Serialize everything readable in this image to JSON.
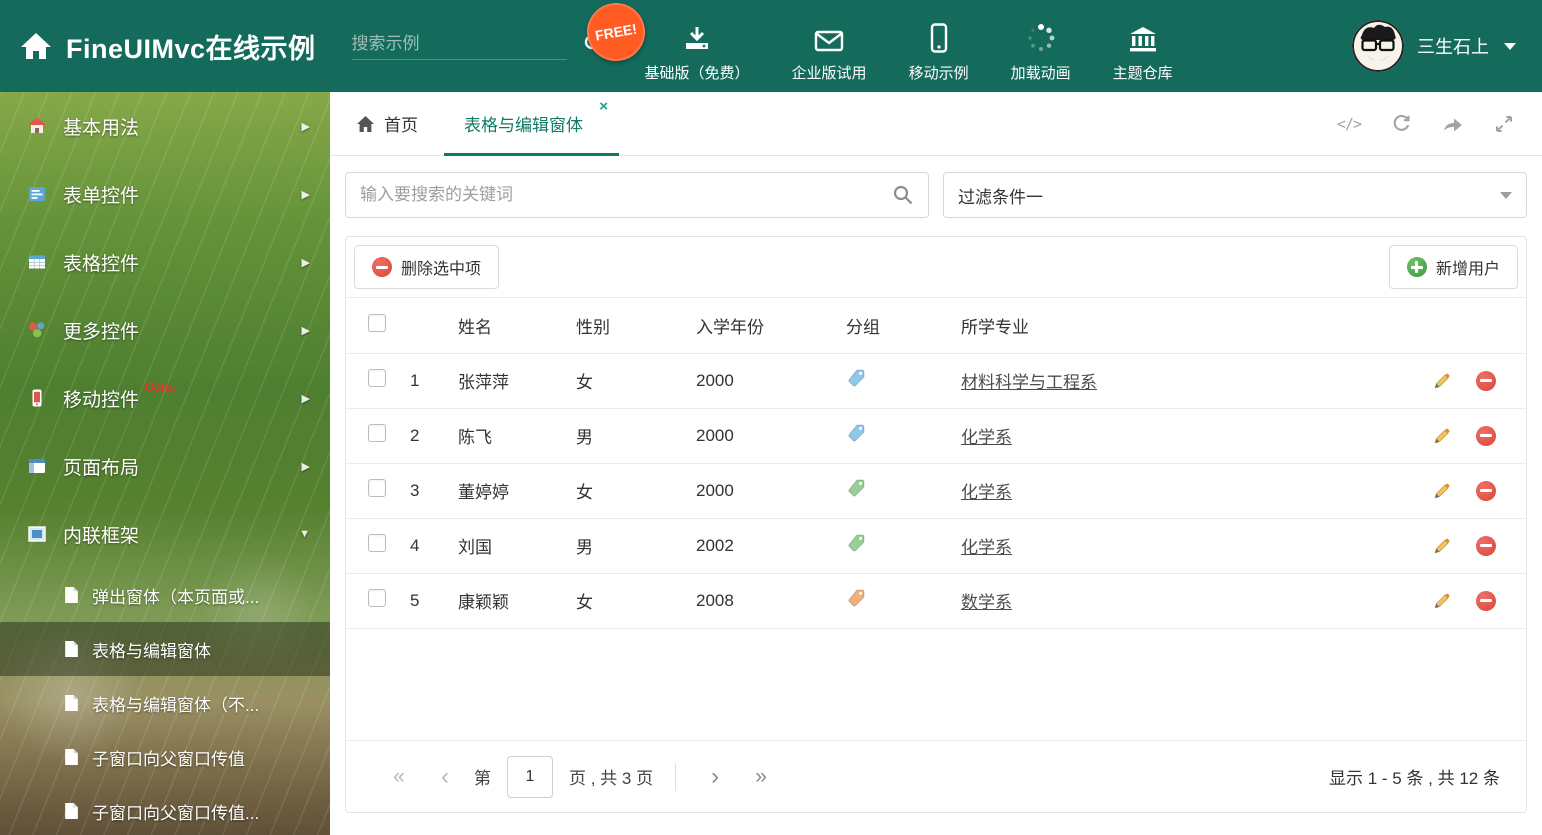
{
  "colors": {
    "header_bg": "#146b5c",
    "accent": "#107a67",
    "free_badge": "#ff5b22",
    "delete_red": "#d9443a",
    "add_green": "#3c9a41",
    "corp_red": "#ff2a2a",
    "tag_blue": "#8fc9ea",
    "tag_green": "#96d096",
    "tag_orange": "#f3b079"
  },
  "header": {
    "title": "FineUIMvc在线示例",
    "search_placeholder": "搜索示例",
    "free_badge": "FREE!",
    "nav_items": [
      {
        "label": "基础版（免费）",
        "icon": "download-icon"
      },
      {
        "label": "企业版试用",
        "icon": "mail-icon"
      },
      {
        "label": "移动示例",
        "icon": "mobile-icon"
      },
      {
        "label": "加载动画",
        "icon": "spinner-icon"
      },
      {
        "label": "主题仓库",
        "icon": "bank-icon"
      }
    ],
    "username": "三生石上"
  },
  "sidebar": {
    "items": [
      {
        "label": "基本用法"
      },
      {
        "label": "表单控件"
      },
      {
        "label": "表格控件"
      },
      {
        "label": "更多控件"
      },
      {
        "label": "移动控件",
        "badge": "Corp."
      },
      {
        "label": "页面布局"
      },
      {
        "label": "内联框架"
      }
    ],
    "subitems": [
      {
        "label": "弹出窗体（本页面或..."
      },
      {
        "label": "表格与编辑窗体"
      },
      {
        "label": "表格与编辑窗体（不..."
      },
      {
        "label": "子窗口向父窗口传值"
      },
      {
        "label": "子窗口向父窗口传值..."
      }
    ]
  },
  "tabs": {
    "home_label": "首页",
    "active_label": "表格与编辑窗体"
  },
  "filter": {
    "search_placeholder": "输入要搜索的关键词",
    "dropdown_value": "过滤条件一"
  },
  "toolbar": {
    "delete_label": "删除选中项",
    "add_label": "新增用户"
  },
  "table": {
    "columns": [
      "姓名",
      "性别",
      "入学年份",
      "分组",
      "所学专业"
    ],
    "rows": [
      {
        "num": "1",
        "name": "张萍萍",
        "gender": "女",
        "year": "2000",
        "tag": "blue",
        "major": "材料科学与工程系"
      },
      {
        "num": "2",
        "name": "陈飞",
        "gender": "男",
        "year": "2000",
        "tag": "blue",
        "major": "化学系"
      },
      {
        "num": "3",
        "name": "董婷婷",
        "gender": "女",
        "year": "2000",
        "tag": "green",
        "major": "化学系"
      },
      {
        "num": "4",
        "name": "刘国",
        "gender": "男",
        "year": "2002",
        "tag": "green",
        "major": "化学系"
      },
      {
        "num": "5",
        "name": "康颖颖",
        "gender": "女",
        "year": "2008",
        "tag": "orange",
        "major": "数学系"
      }
    ]
  },
  "pagination": {
    "prefix": "第",
    "page": "1",
    "suffix": "页 , 共 3 页",
    "summary": "显示 1 - 5 条 , 共 12 条"
  }
}
